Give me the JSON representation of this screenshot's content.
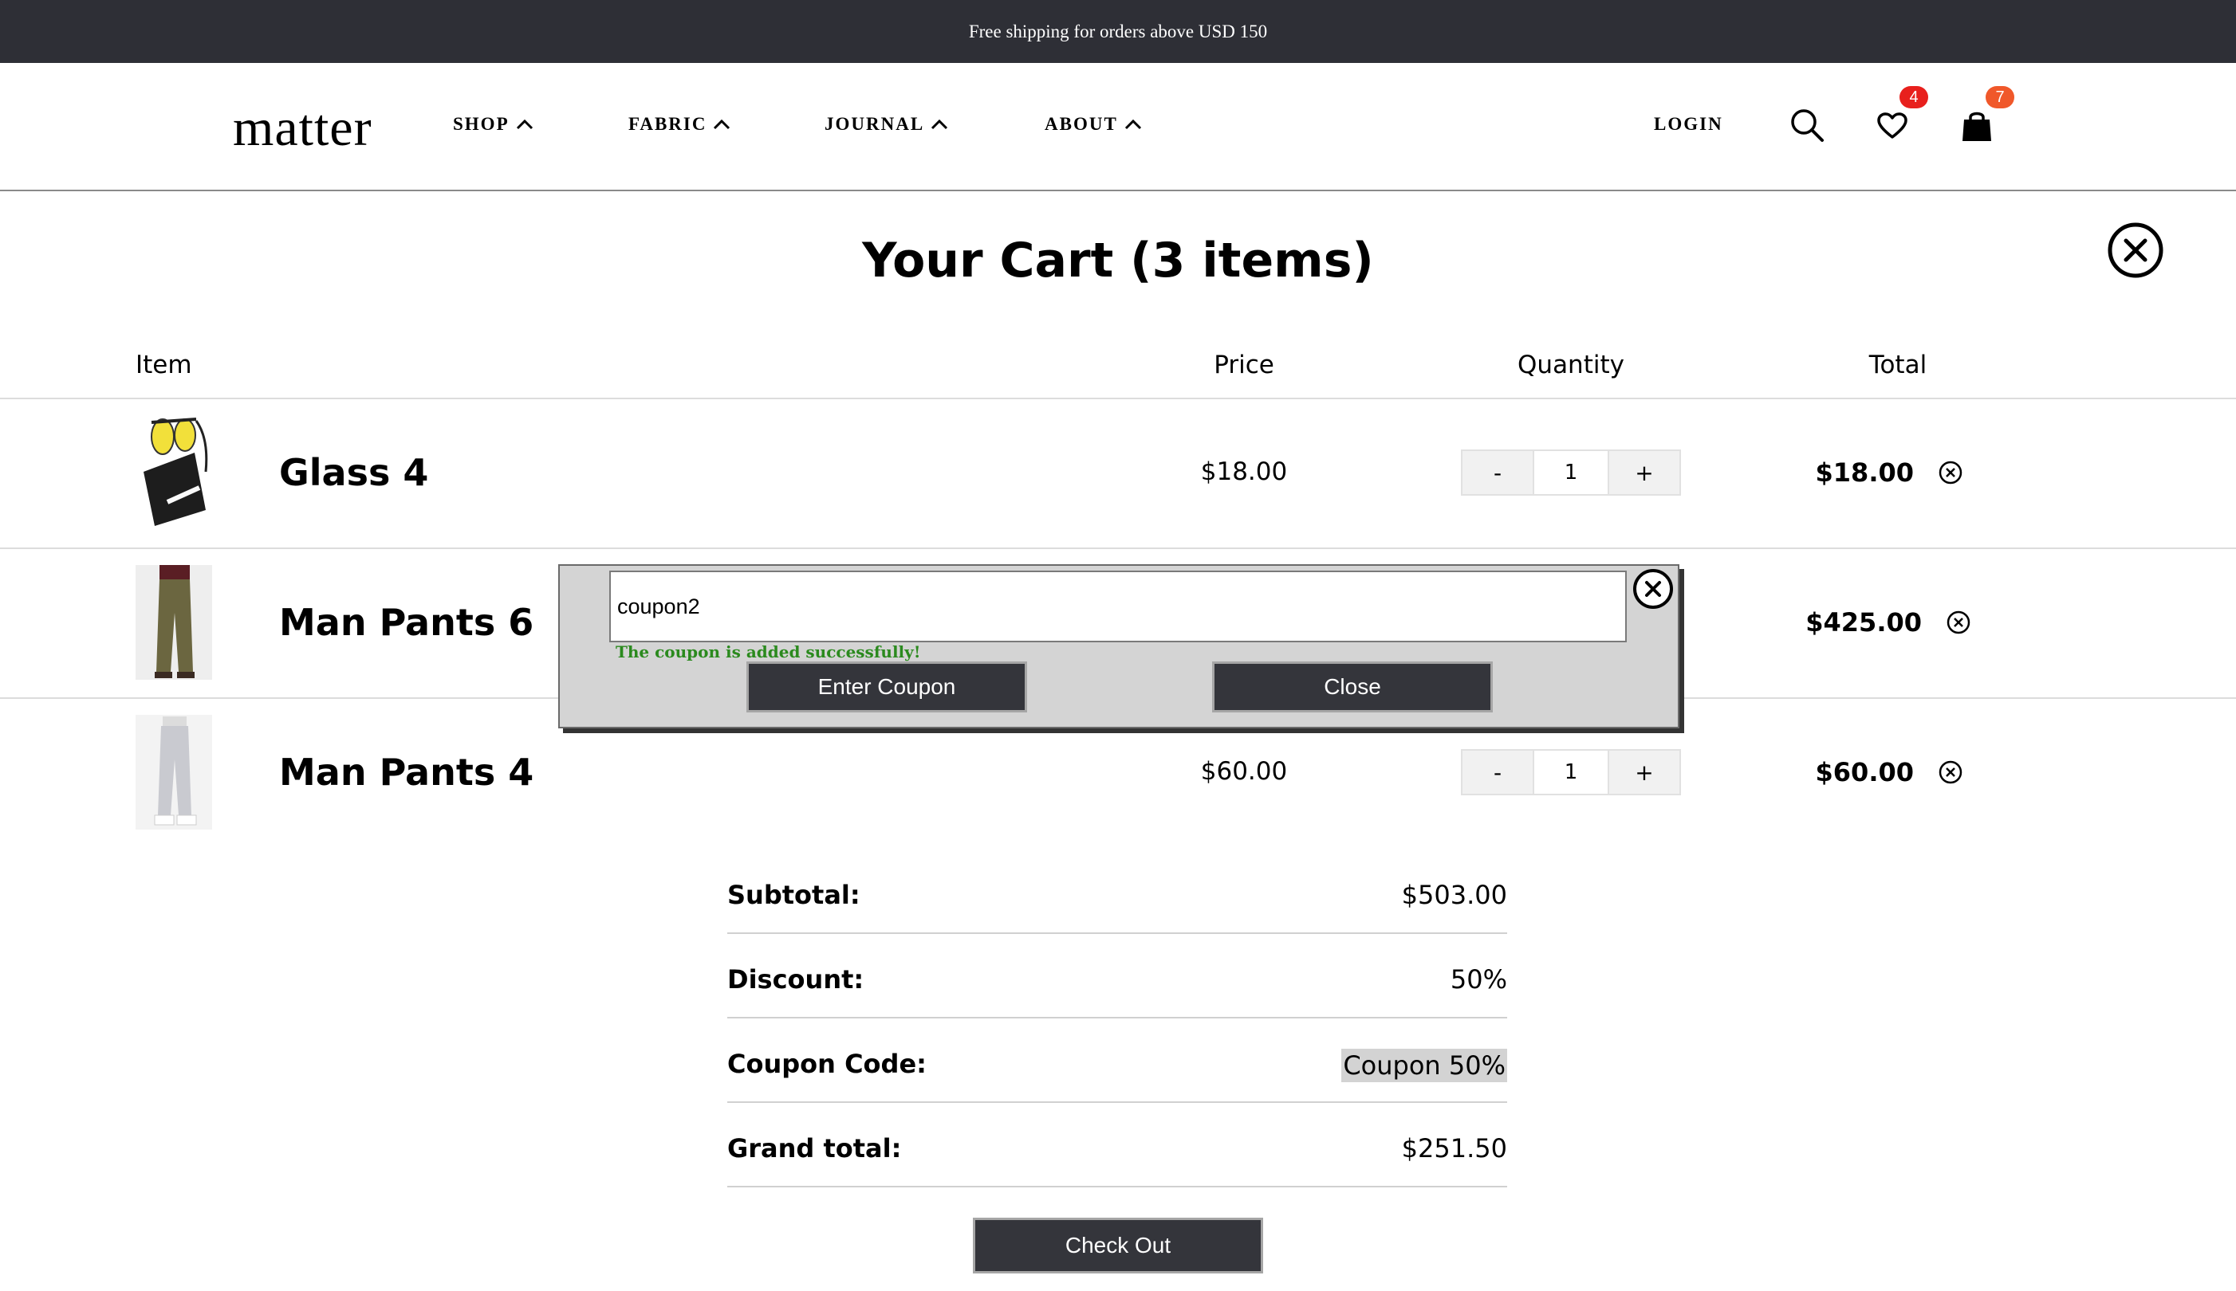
{
  "promo": {
    "text": "Free shipping for orders above USD 150"
  },
  "header": {
    "logo": "matter",
    "nav": [
      {
        "label": "SHOP"
      },
      {
        "label": "FABRIC"
      },
      {
        "label": "JOURNAL"
      },
      {
        "label": "ABOUT"
      }
    ],
    "login_label": "LOGIN",
    "wishlist_count": "4",
    "cart_count": "7",
    "colors": {
      "wishlist_badge": "#e8201d",
      "cart_badge": "#f0582a",
      "promo_bar": "#2e2f36"
    }
  },
  "cart": {
    "title": "Your Cart (3 items)",
    "columns": {
      "item": "Item",
      "price": "Price",
      "quantity": "Quantity",
      "total": "Total"
    },
    "items": [
      {
        "name": "Glass 4",
        "price": "$18.00",
        "qty_minus": "-",
        "qty": "1",
        "qty_plus": "+",
        "total": "$18.00"
      },
      {
        "name": "Man Pants 6",
        "price": "",
        "qty_minus": "-",
        "qty": "",
        "qty_plus": "+",
        "total": "$425.00"
      },
      {
        "name": "Man Pants 4",
        "price": "$60.00",
        "qty_minus": "-",
        "qty": "1",
        "qty_plus": "+",
        "total": "$60.00"
      }
    ]
  },
  "summary": {
    "subtotal_label": "Subtotal:",
    "subtotal": "$503.00",
    "discount_label": "Discount:",
    "discount": "50%",
    "coupon_label": "Coupon Code:",
    "coupon": "Coupon 50%",
    "grand_label": "Grand total:",
    "grand": "$251.50",
    "checkout_label": "Check Out"
  },
  "coupon_modal": {
    "input_value": "coupon2",
    "success_message": "The coupon is added successfully!",
    "enter_label": "Enter Coupon",
    "close_label": "Close"
  }
}
